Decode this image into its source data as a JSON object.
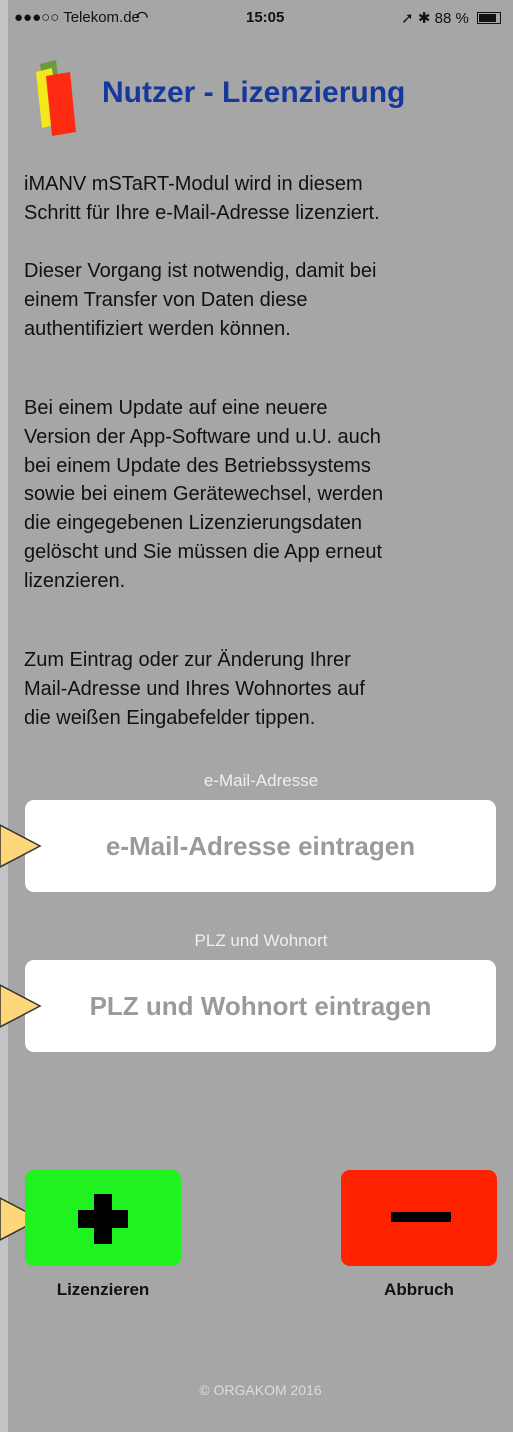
{
  "status_bar": {
    "carrier": "●●●○○ Telekom.de",
    "wifi_icon": "wifi-icon",
    "time": "15:05",
    "location_icon": "location-arrow-icon",
    "bluetooth_icon": "bluetooth-icon",
    "battery_percent": "88 %",
    "battery_level": 0.88
  },
  "header": {
    "logo_icon": "app-logo-icon",
    "title": "Nutzer - Lizenzierung"
  },
  "paragraphs": [
    "iMANV mSTaRT-Modul wird in diesem\nSchritt für Ihre e-Mail-Adresse lizenziert.",
    "Dieser Vorgang ist notwendig, damit bei\neinem Transfer von Daten diese\nauthentifiziert werden können.",
    "Bei einem Update auf eine neuere\nVersion der App-Software und u.U. auch\nbei einem Update des Betriebssystems\nsowie bei einem Gerätewechsel, werden\ndie eingegebenen Lizenzierungsdaten\ngelöscht und Sie müssen die App erneut\nlizenzieren.",
    "Zum Eintrag oder zur Änderung Ihrer\nMail-Adresse und Ihres Wohnortes auf\ndie weißen Eingabefelder tippen."
  ],
  "form": {
    "email_label": "e-Mail-Adresse",
    "email_placeholder": "e-Mail-Adresse eintragen",
    "email_value": "",
    "plz_label": "PLZ und Wohnort",
    "plz_placeholder": "PLZ und Wohnort eintragen",
    "plz_value": ""
  },
  "buttons": {
    "license_label": "Lizenzieren",
    "license_icon": "plus-icon",
    "cancel_label": "Abbruch",
    "cancel_icon": "minus-icon"
  },
  "footer": "© ORGAKOM 2016",
  "colors": {
    "background": "#a6a6a6",
    "title": "#16389c",
    "add_button": "#1ff21f",
    "cancel_button": "#ff2200",
    "callout_arrow": "#fdd77a"
  }
}
